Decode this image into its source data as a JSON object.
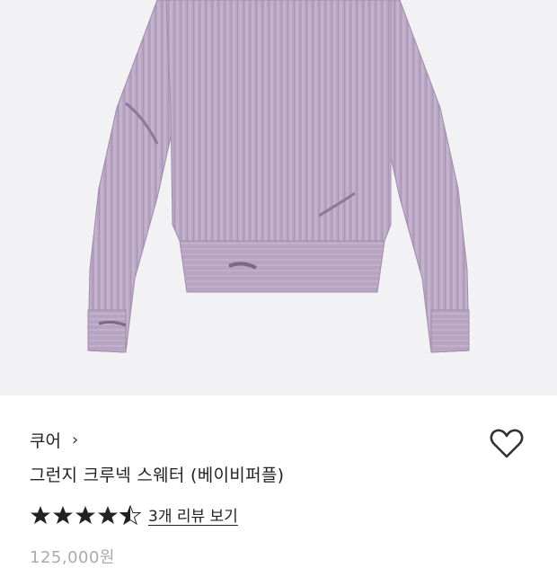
{
  "product": {
    "brand": "쿠어",
    "brand_chevron": "›",
    "title": "그런지 크루넥 스웨터 (베이비퍼플)",
    "rating": 4.5,
    "max_rating": 5,
    "review_link": "3개 리뷰 보기",
    "price_partial": "125,000원"
  },
  "colors": {
    "sweater": "#b9a6c4",
    "background": "#f2f1f3",
    "star": "#222222"
  },
  "icons": {
    "wishlist": "heart-outline-icon",
    "brand_nav": "chevron-right-icon",
    "rating": "star-icon"
  }
}
